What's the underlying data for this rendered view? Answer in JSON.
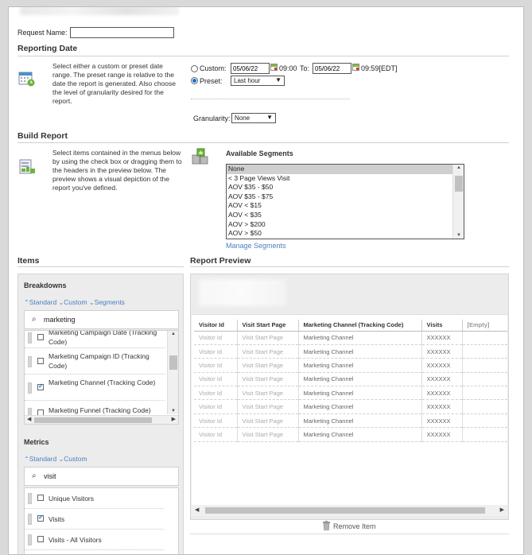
{
  "header": {
    "request_name_label": "Request Name:",
    "request_name_value": ""
  },
  "reporting_date": {
    "title": "Reporting Date",
    "description": "Select either a custom or preset date range. The preset range is relative to the date the report is generated. Also choose the level of granularity desired for the report.",
    "custom_label": "Custom:",
    "custom_from_date": "05/06/22",
    "custom_from_time": "09:00",
    "to_label": "To:",
    "custom_to_date": "05/06/22",
    "custom_to_time": "09:59[EDT]",
    "preset_label": "Preset:",
    "preset_value": "Last hour",
    "selected_mode": "preset",
    "granularity_label": "Granularity:",
    "granularity_value": "None"
  },
  "build_report": {
    "title": "Build Report",
    "description": "Select items contained in the menus below by using the check box or dragging them to the headers in the preview below. The preview shows a visual depiction of the report you've defined.",
    "segments_title": "Available Segments",
    "segments": [
      "None",
      "< 3 Page Views Visit",
      "AOV $35 - $50",
      "AOV $35 - $75",
      "AOV < $15",
      "AOV < $35",
      "AOV > $200",
      "AOV > $50"
    ],
    "selected_segment": "None",
    "manage_segments_label": "Manage Segments"
  },
  "items": {
    "title": "Items",
    "breakdowns": {
      "title": "Breakdowns",
      "tabs": [
        "Standard",
        "Custom",
        "Segments"
      ],
      "search_value": "marketing",
      "list": [
        {
          "label": "Marketing Campaign Date (Tracking Code)",
          "checked": false
        },
        {
          "label": "Marketing Campaign ID (Tracking Code)",
          "checked": false
        },
        {
          "label": "Marketing Channel (Tracking Code)",
          "checked": true
        },
        {
          "label": "Marketing Funnel (Tracking Code)",
          "checked": false
        }
      ]
    },
    "metrics": {
      "title": "Metrics",
      "tabs": [
        "Standard",
        "Custom"
      ],
      "search_value": "visit",
      "list": [
        {
          "label": "Unique Visitors",
          "checked": false
        },
        {
          "label": "Visits",
          "checked": true
        },
        {
          "label": "Visits - All Visitors",
          "checked": false
        }
      ]
    }
  },
  "report_preview": {
    "title": "Report Preview",
    "columns": [
      "Visitor Id",
      "Visit Start Page",
      "Marketing Channel (Tracking Code)",
      "Visits",
      "[Empty]"
    ],
    "rows": [
      [
        "Visitor Id",
        "Visit Start Page",
        "Marketing Channel",
        "XXXXXX",
        ""
      ],
      [
        "Visitor Id",
        "Visit Start Page",
        "Marketing Channel",
        "XXXXXX",
        ""
      ],
      [
        "Visitor Id",
        "Visit Start Page",
        "Marketing Channel",
        "XXXXXX",
        ""
      ],
      [
        "Visitor Id",
        "Visit Start Page",
        "Marketing Channel",
        "XXXXXX",
        ""
      ],
      [
        "Visitor Id",
        "Visit Start Page",
        "Marketing Channel",
        "XXXXXX",
        ""
      ],
      [
        "Visitor Id",
        "Visit Start Page",
        "Marketing Channel",
        "XXXXXX",
        ""
      ],
      [
        "Visitor Id",
        "Visit Start Page",
        "Marketing Channel",
        "XXXXXX",
        ""
      ],
      [
        "Visitor Id",
        "Visit Start Page",
        "Marketing Channel",
        "XXXXXX",
        ""
      ]
    ],
    "remove_item_label": "Remove Item"
  },
  "icons": {
    "calendar": "calendar-icon",
    "build_report": "build-report-icon",
    "segments": "segments-icon",
    "search": "search-icon",
    "trash": "trash-icon"
  },
  "colors": {
    "accent_link": "#4a7fc1",
    "radio_selected": "#1a6fd4",
    "panel_bg": "#ececec"
  }
}
